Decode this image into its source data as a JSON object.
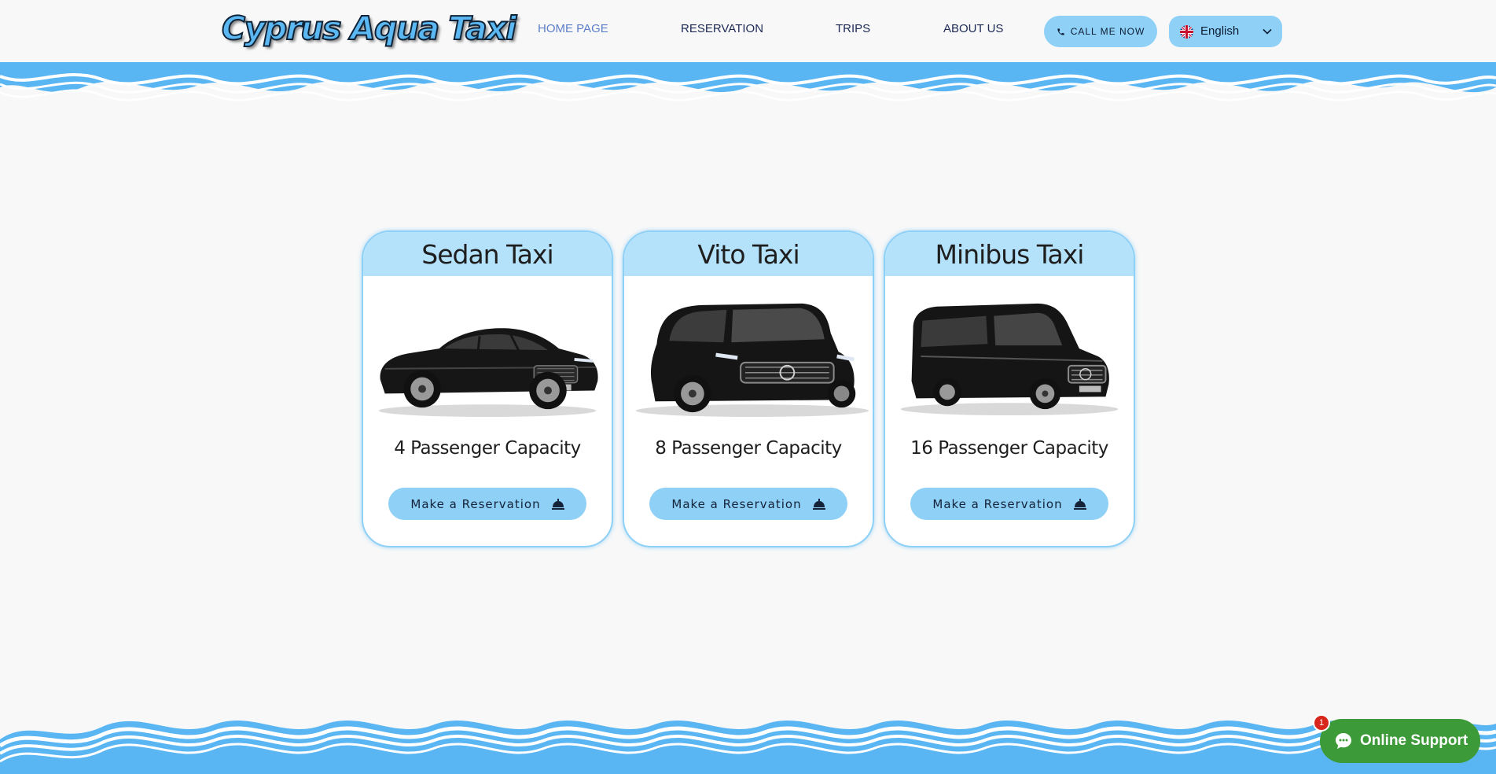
{
  "header": {
    "logo": "Cyprus Aqua Taxi",
    "nav": [
      {
        "label": "HOME PAGE",
        "active": true
      },
      {
        "label": "RESERVATION",
        "active": false
      },
      {
        "label": "TRIPS",
        "active": false
      },
      {
        "label": "ABOUT US",
        "active": false
      }
    ],
    "call_button": "CALL ME NOW",
    "language": "English"
  },
  "cards": [
    {
      "title": "Sedan Taxi",
      "capacity": "4 Passenger Capacity",
      "button": "Make a Reservation"
    },
    {
      "title": "Vito Taxi",
      "capacity": "8 Passenger Capacity",
      "button": "Make a Reservation"
    },
    {
      "title": "Minibus Taxi",
      "capacity": "16 Passenger Capacity",
      "button": "Make a Reservation"
    }
  ],
  "support": {
    "label": "Online Support",
    "badge": "1"
  },
  "colors": {
    "accent": "#8fd0f6",
    "card_header": "#b5e2fb",
    "wave": "#5ab5f3",
    "support": "#3d9a39",
    "badge": "#d8261c"
  }
}
